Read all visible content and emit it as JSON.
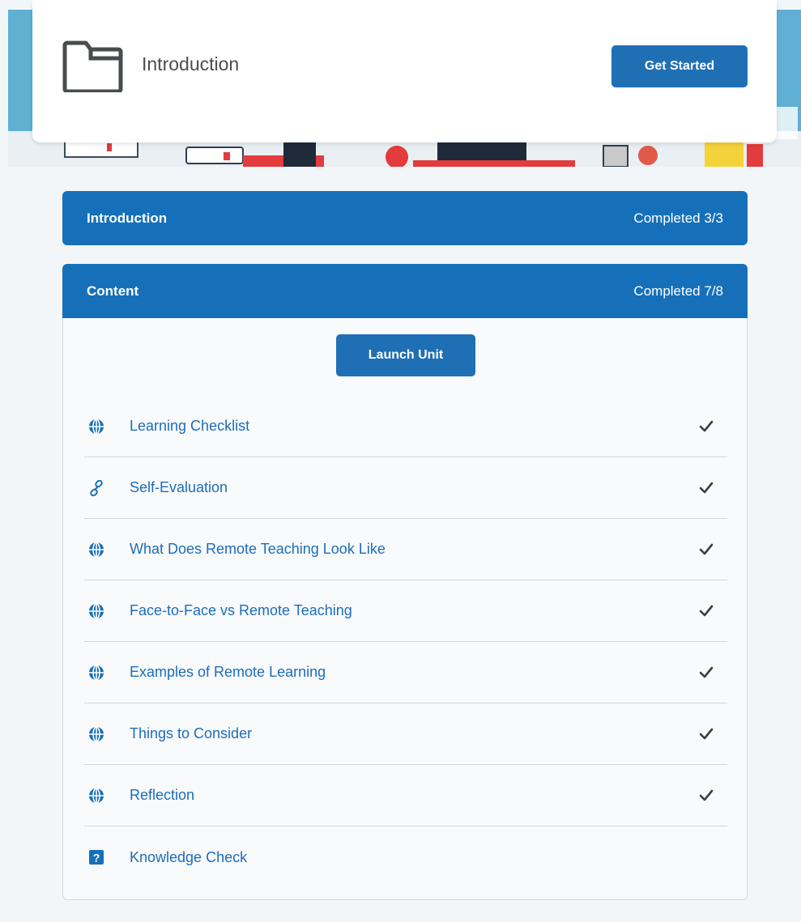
{
  "header_card": {
    "title": "Introduction",
    "button_label": "Get Started",
    "folder_icon": "folder-icon"
  },
  "sections": {
    "introduction": {
      "title": "Introduction",
      "status": "Completed 3/3"
    },
    "content": {
      "title": "Content",
      "status": "Completed 7/8",
      "launch_label": "Launch Unit"
    }
  },
  "content_items": [
    {
      "label": "Learning Checklist",
      "icon": "globe-icon",
      "completed": true
    },
    {
      "label": "Self-Evaluation",
      "icon": "link-icon",
      "completed": true
    },
    {
      "label": "What Does Remote Teaching Look Like",
      "icon": "globe-icon",
      "completed": true
    },
    {
      "label": "Face-to-Face vs Remote Teaching",
      "icon": "globe-icon",
      "completed": true
    },
    {
      "label": "Examples of Remote Learning",
      "icon": "globe-icon",
      "completed": true
    },
    {
      "label": "Things to Consider",
      "icon": "globe-icon",
      "completed": true
    },
    {
      "label": "Reflection",
      "icon": "globe-icon",
      "completed": true
    },
    {
      "label": "Knowledge Check",
      "icon": "quiz-icon",
      "completed": false
    }
  ],
  "colors": {
    "primary": "#1670b9",
    "link": "#1b6dbb",
    "background": "#f3f6f9"
  }
}
